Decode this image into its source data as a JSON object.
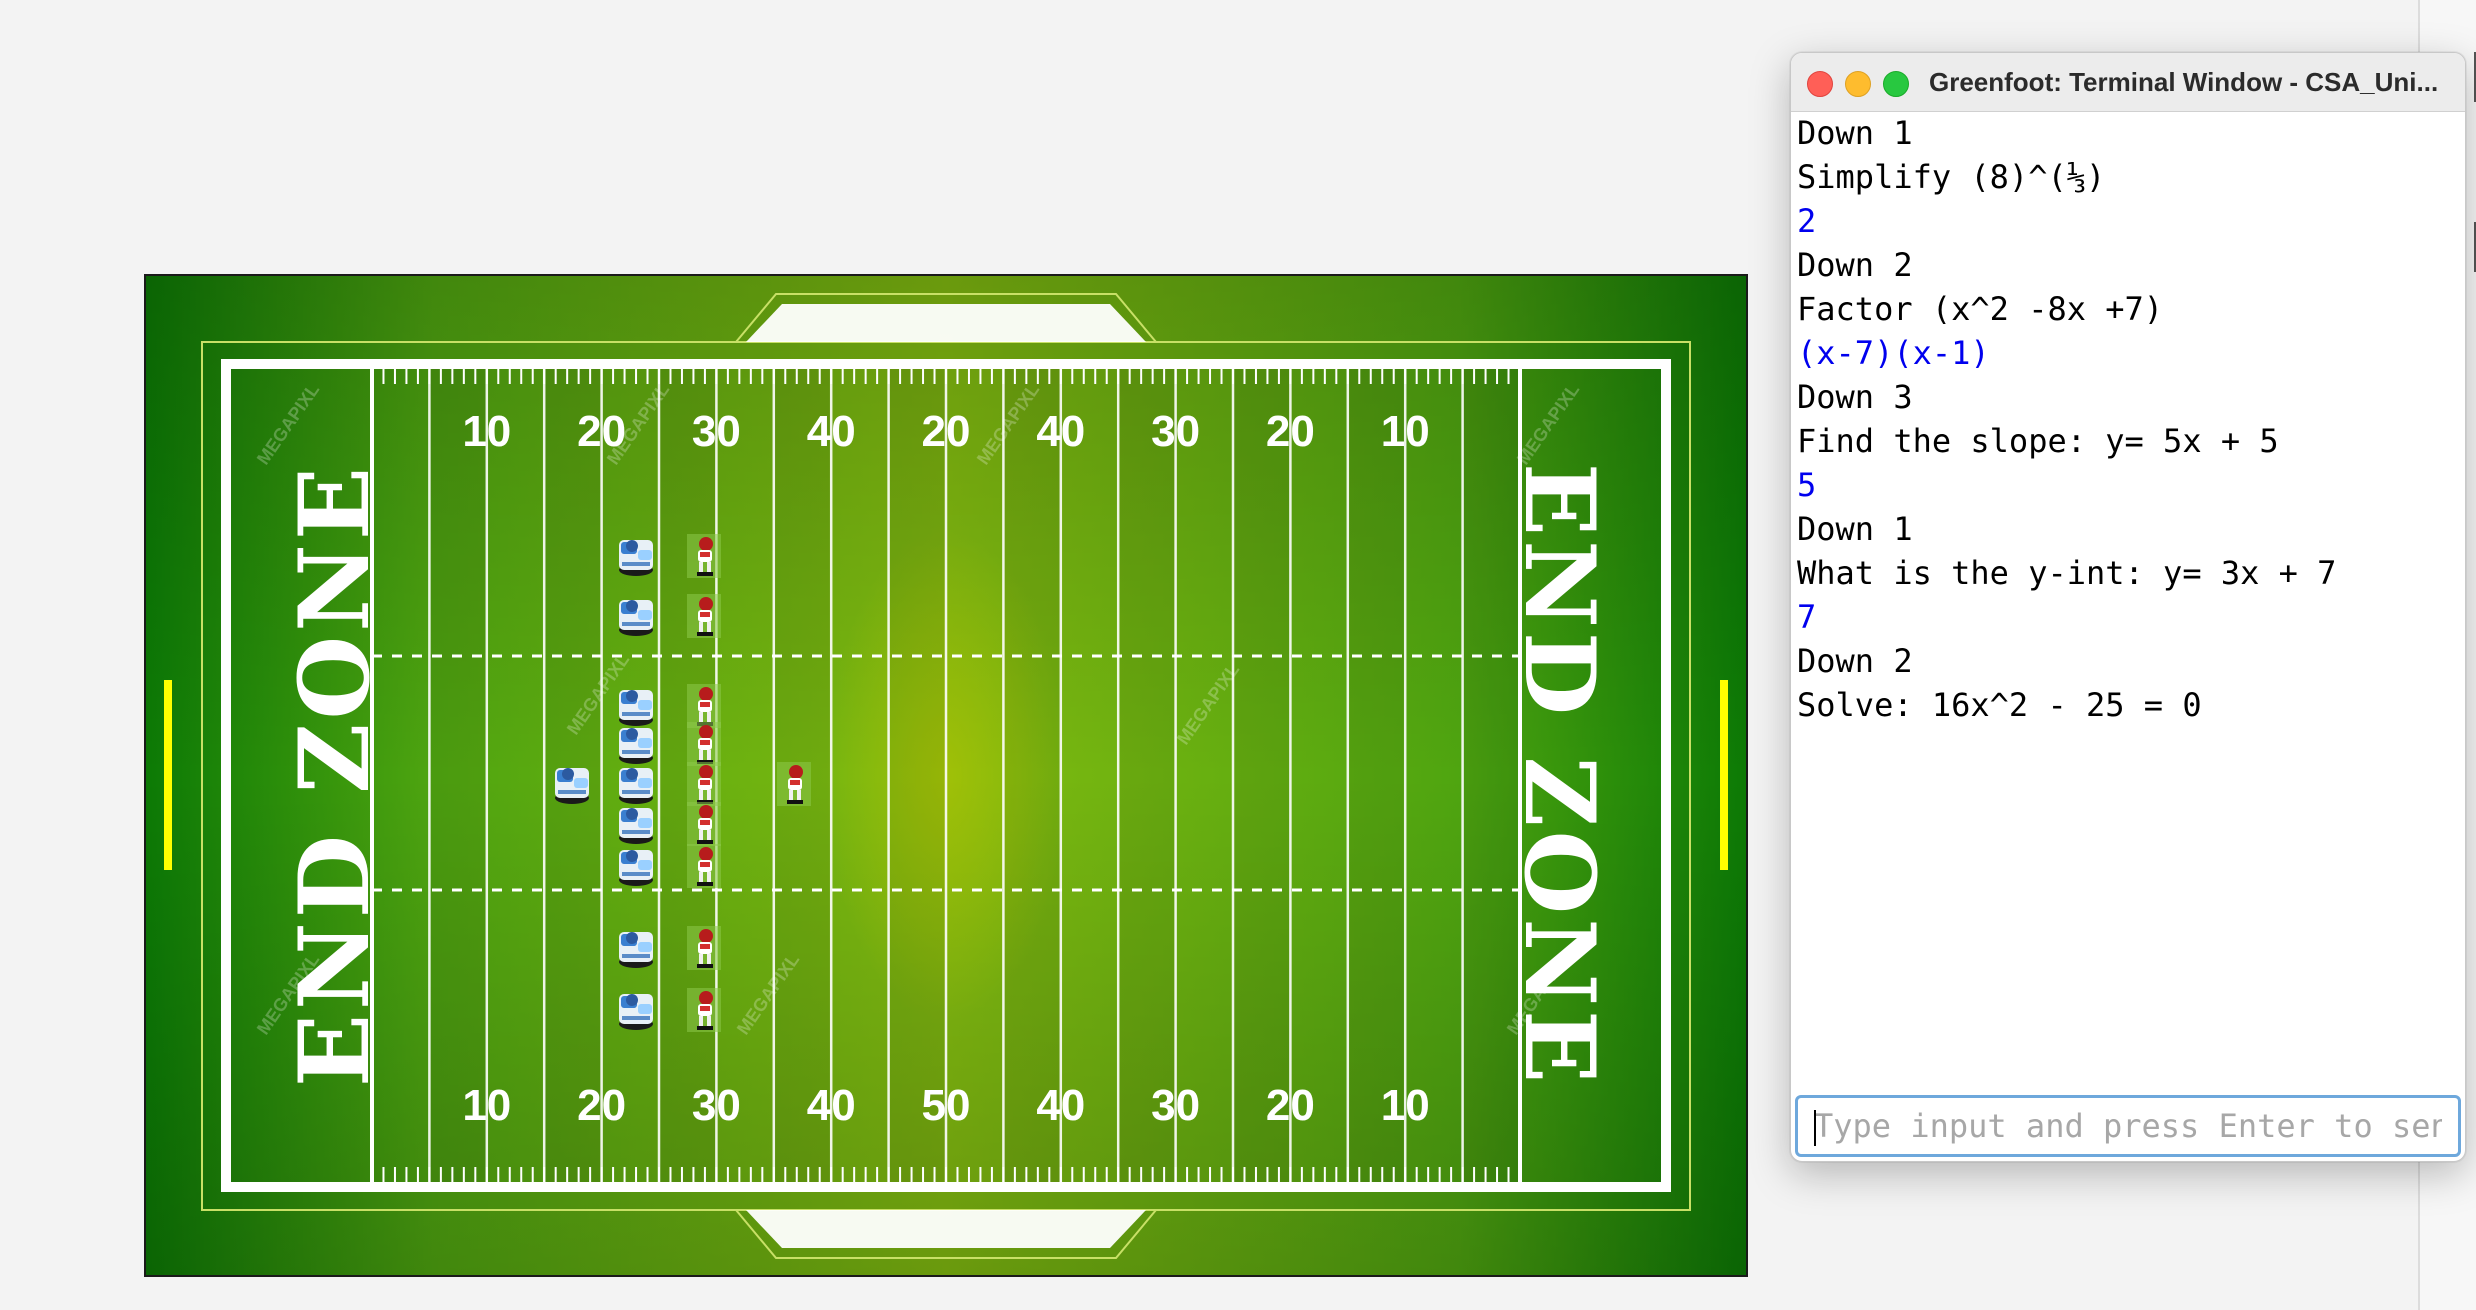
{
  "colors": {
    "field_dark": "#0c7a05",
    "field_light": "#72b90f",
    "field_center": "#a9c400",
    "goalpost": "#ffff00",
    "line": "#ffffff",
    "input_text": "#0000ee"
  },
  "field": {
    "end_zone_label": "END ZONE",
    "top_numbers": [
      "10",
      "20",
      "30",
      "40",
      "20",
      "40",
      "30",
      "20",
      "10"
    ],
    "bottom_numbers": [
      "10",
      "20",
      "30",
      "40",
      "50",
      "40",
      "30",
      "20",
      "10"
    ],
    "watermark": "MEGAPIXL",
    "player_icons": [
      "blue-team-player-icon",
      "red-team-player-icon"
    ]
  },
  "terminal": {
    "title": "Greenfoot: Terminal Window - CSA_Uni...",
    "lines": [
      {
        "text": "Down 1",
        "kind": "output"
      },
      {
        "text": "Simplify (8)^(⅓)",
        "kind": "output"
      },
      {
        "text": "2",
        "kind": "input"
      },
      {
        "text": "Down 2",
        "kind": "output"
      },
      {
        "text": "Factor (x^2 -8x +7)",
        "kind": "output"
      },
      {
        "text": "(x-7)(x-1)",
        "kind": "input"
      },
      {
        "text": "Down 3",
        "kind": "output"
      },
      {
        "text": "Find the slope: y= 5x + 5",
        "kind": "output"
      },
      {
        "text": "5",
        "kind": "input"
      },
      {
        "text": "Down 1",
        "kind": "output"
      },
      {
        "text": "What is the y-int: y= 3x + 7",
        "kind": "output"
      },
      {
        "text": "7",
        "kind": "input"
      },
      {
        "text": "Down 2",
        "kind": "output"
      },
      {
        "text": "Solve: 16x^2 - 25 = 0",
        "kind": "output"
      }
    ],
    "input_placeholder": "Type input and press Enter to send"
  }
}
